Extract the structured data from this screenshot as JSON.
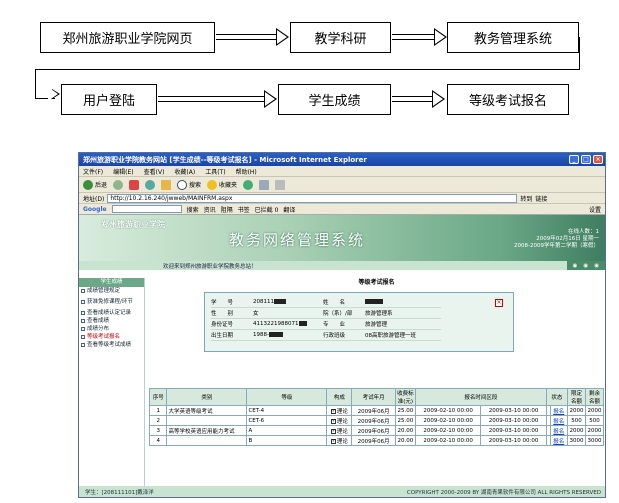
{
  "flow": {
    "box1": "郑州旅游职业学院网页",
    "box2": "教学科研",
    "box3": "教务管理系统",
    "box4": "用户登陆",
    "box5": "学生成绩",
    "box6": "等级考试报名"
  },
  "browser": {
    "title": "郑州旅游职业学院教务网站 [学生成绩--等级考试报名] - Microsoft Internet Explorer",
    "menu": [
      "文件(F)",
      "编辑(E)",
      "查看(V)",
      "收藏(A)",
      "工具(T)",
      "帮助(H)"
    ],
    "toolbar": {
      "back": "后退",
      "search": "搜索",
      "favorites": "收藏夹"
    },
    "address": {
      "label": "地址(D)",
      "value": "http://10.2.16.240/jwweb/MAINFRM.aspx",
      "go": "转到",
      "links": "链接"
    },
    "google": {
      "brand": "Google",
      "search_btn": "搜索",
      "info": "资讯",
      "blocked": "阻隔",
      "bookmark": "书签",
      "blocked_count": "已拦截 0",
      "translate": "翻译",
      "setting": "设置"
    },
    "banner": {
      "school": "郑州旅游职业学院",
      "system_name": "教务网络管理系统",
      "online": "在线人数：1",
      "date": "2009年02月16日 星期一",
      "term": "2008-2009学年第二学期（寒假）"
    },
    "welcome": "欢迎来到郑州旅游职业学院教务总站！"
  },
  "sidebar": {
    "header": "学生成绩",
    "items": [
      {
        "label": "成绩管理规定",
        "active": false
      },
      {
        "label": "获准免修课程/环节",
        "active": false
      },
      {
        "label": "查看成绩认定记录",
        "active": false
      },
      {
        "label": "查看成绩",
        "active": false
      },
      {
        "label": "成绩分布",
        "active": false
      },
      {
        "label": "等级考试报名",
        "active": true
      },
      {
        "label": "查看等级考试成绩",
        "active": false
      }
    ]
  },
  "main": {
    "title": "等级考试报名",
    "student": {
      "id_label": "学　　号",
      "id_value": "208111",
      "name_label": "姓　　名",
      "gender_label": "性　　别",
      "gender_value": "女",
      "dept_label": "院（系）/部",
      "dept_value": "旅游管理系",
      "idcard_label": "身份证号",
      "idcard_value": "4113221988071",
      "major_label": "专　　业",
      "major_value": "旅游管理",
      "birth_label": "出生日期",
      "birth_value": "1988-",
      "class_label": "行政班级",
      "class_value": "08高职旅游管理一班"
    },
    "table": {
      "headers": [
        "序号",
        "类别",
        "等级",
        "构成",
        "考试年月",
        "收费标准(元)",
        "报名时间区段",
        "",
        "状态",
        "",
        "限定名额",
        "剩余名额"
      ],
      "rows": [
        {
          "no": "1",
          "category": "大学英语等级考试",
          "level": "CET-4",
          "part": "理论",
          "date": "2009年06月",
          "fee": "25.00",
          "start": "2009-02-10 00:00",
          "end": "2009-03-10 00:00",
          "status": "",
          "action": "报名",
          "limit": "2000",
          "remain": "2000"
        },
        {
          "no": "2",
          "category": "",
          "level": "CET-6",
          "part": "理论",
          "date": "2009年06月",
          "fee": "25.00",
          "start": "2009-02-10 00:00",
          "end": "2009-03-10 00:00",
          "status": "",
          "action": "报名",
          "limit": "500",
          "remain": "500"
        },
        {
          "no": "3",
          "category": "高等学校英语应用能力考试",
          "level": "A",
          "part": "理论",
          "date": "2009年06月",
          "fee": "20.00",
          "start": "2009-02-10 00:00",
          "end": "2009-03-10 00:00",
          "status": "",
          "action": "报名",
          "limit": "2000",
          "remain": "2000"
        },
        {
          "no": "4",
          "category": "",
          "level": "B",
          "part": "理论",
          "date": "2009年06月",
          "fee": "20.00",
          "start": "2009-02-10 00:00",
          "end": "2009-03-10 00:00",
          "status": "",
          "action": "报名",
          "limit": "3000",
          "remain": "3000"
        }
      ]
    }
  },
  "footer": {
    "student": "学生：[208111101]戴泽洋",
    "copyright": "COPYRIGHT 2000-2009 BY 湖南青果软件有限公司 ALL RIGHTS RESERVED"
  }
}
